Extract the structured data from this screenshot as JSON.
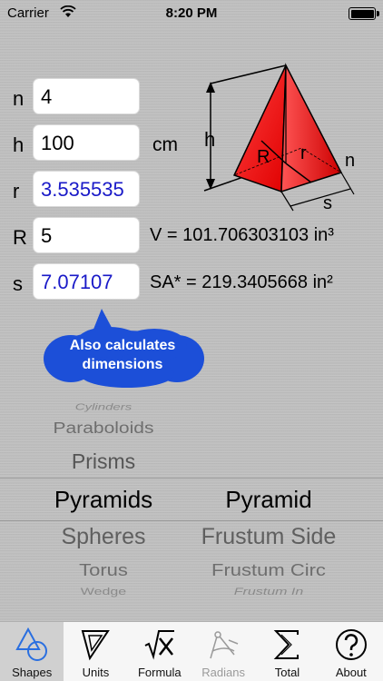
{
  "status": {
    "carrier": "Carrier",
    "time": "8:20 PM"
  },
  "inputs": [
    {
      "label": "n",
      "value": "4",
      "computed": false
    },
    {
      "label": "h",
      "value": "100",
      "computed": false,
      "unit": "cm"
    },
    {
      "label": "r",
      "value": "3.535535",
      "computed": true
    },
    {
      "label": "R",
      "value": "5",
      "computed": false
    },
    {
      "label": "s",
      "value": "7.07107",
      "computed": true
    }
  ],
  "results": {
    "volume": "V = 101.706303103 in³",
    "surface_area": "SA* = 219.3405668 in²"
  },
  "diagram": {
    "label_h": "h",
    "label_R": "R",
    "label_r": "r",
    "label_n": "n",
    "label_s": "s"
  },
  "bubble": {
    "line1": "Also calculates",
    "line2": "dimensions"
  },
  "picker": {
    "left": [
      "Cylinders",
      "Paraboloids",
      "Prisms",
      "Pyramids",
      "Spheres",
      "Torus",
      "Wedge"
    ],
    "right": [
      "Pyramid",
      "Frustum Side",
      "Frustum Circ",
      "Frustum In"
    ],
    "selected_left": "Pyramids",
    "selected_right": "Pyramid"
  },
  "tabs": [
    {
      "label": "Shapes",
      "active": true,
      "disabled": false
    },
    {
      "label": "Units",
      "active": false,
      "disabled": false
    },
    {
      "label": "Formula",
      "active": false,
      "disabled": false
    },
    {
      "label": "Radians",
      "active": false,
      "disabled": true
    },
    {
      "label": "Total",
      "active": false,
      "disabled": false
    },
    {
      "label": "About",
      "active": false,
      "disabled": false
    }
  ],
  "colors": {
    "pyramid": "#ff1a1a",
    "computed_text": "#1a1ac8",
    "bubble": "#1c4fd8",
    "active_tab_icon": "#2a6fe0"
  }
}
